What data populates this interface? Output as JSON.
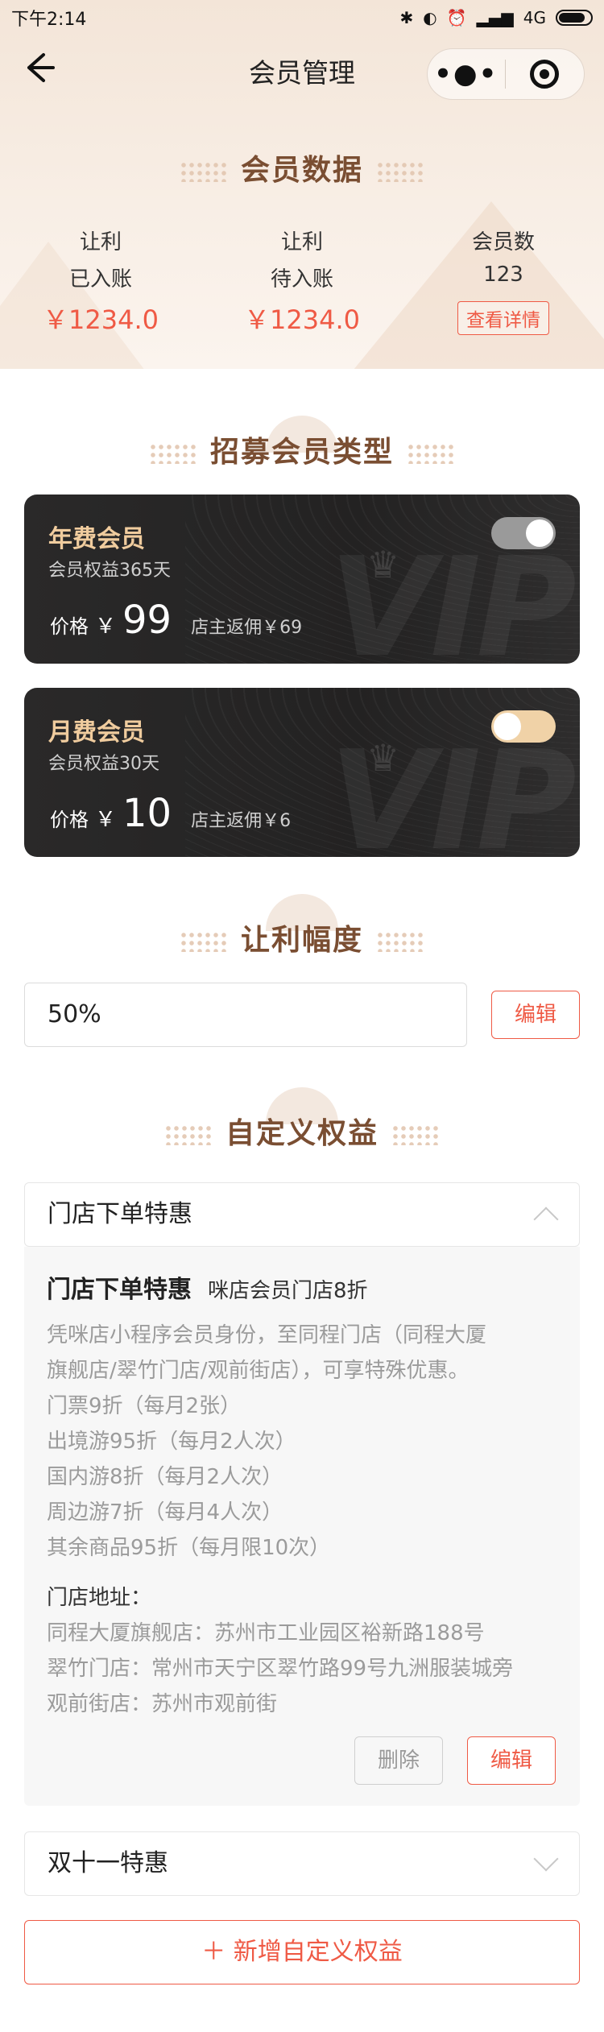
{
  "status_bar": {
    "time": "下午2:14",
    "network": "4G"
  },
  "nav": {
    "back_icon": "arrow-left-icon",
    "title": "会员管理"
  },
  "member_data": {
    "title": "会员数据",
    "settled": {
      "l1": "让利",
      "l2": "已入账",
      "amount": "￥1234.0"
    },
    "pending": {
      "l1": "让利",
      "l2": "待入账",
      "amount": "￥1234.0"
    },
    "count": {
      "l1": "会员数",
      "value": "123",
      "detail_button": "查看详情"
    }
  },
  "recruit": {
    "title": "招募会员类型",
    "cards": [
      {
        "title": "年费会员",
        "subtitle": "会员权益365天",
        "price_label": "价格",
        "currency": "￥",
        "price": "99",
        "rebate": "店主返佣￥69",
        "enabled": true
      },
      {
        "title": "月费会员",
        "subtitle": "会员权益30天",
        "price_label": "价格",
        "currency": "￥",
        "price": "10",
        "rebate": "店主返佣￥6",
        "enabled": false
      }
    ]
  },
  "discount": {
    "title": "让利幅度",
    "value": "50%",
    "edit_button": "编辑"
  },
  "custom_benefits": {
    "title": "自定义权益",
    "items": [
      {
        "header": "门店下单特惠",
        "expanded": true,
        "body_title": "门店下单特惠",
        "body_subtitle": "咪店会员门店8折",
        "description": [
          "凭咪店小程序会员身份，至同程门店（同程大厦",
          "旗舰店/翠竹门店/观前街店），可享特殊优惠。",
          "门票9折（每月2张）",
          "出境游95折（每月2人次）",
          "国内游8折（每月2人次）",
          "周边游7折（每月4人次）",
          "其余商品95折（每月限10次）"
        ],
        "address_title": "门店地址：",
        "addresses": [
          "同程大厦旗舰店：苏州市工业园区裕新路188号",
          "翠竹门店：常州市天宁区翠竹路99号九洲服装城旁",
          "观前街店：苏州市观前街"
        ],
        "delete_button": "删除",
        "edit_button": "编辑"
      },
      {
        "header": "双十一特惠",
        "expanded": false
      }
    ],
    "add_button": "＋ 新增自定义权益"
  },
  "colors": {
    "accent": "#ef5a45",
    "title_brown": "#7a4e32",
    "card_gold": "#f0cc9e"
  }
}
